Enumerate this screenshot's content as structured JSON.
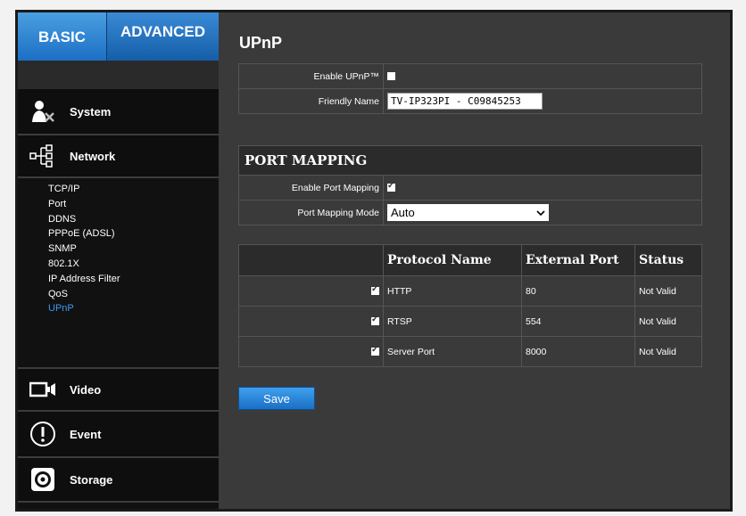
{
  "tabs": {
    "basic": "BASIC",
    "advanced": "ADVANCED"
  },
  "sidebar": {
    "sections": {
      "system": "System",
      "network": "Network",
      "video": "Video",
      "event": "Event",
      "storage": "Storage"
    },
    "network_items": [
      "TCP/IP",
      "Port",
      "DDNS",
      "PPPoE (ADSL)",
      "SNMP",
      "802.1X",
      "IP Address Filter",
      "QoS",
      "UPnP"
    ],
    "active_item": "UPnP"
  },
  "main": {
    "title": "UPnP",
    "enable_upnp_label": "Enable UPnP™",
    "enable_upnp_checked": false,
    "friendly_name_label": "Friendly Name",
    "friendly_name_value": "TV-IP323PI - C09845253",
    "port_mapping_title": "PORT MAPPING",
    "enable_port_mapping_label": "Enable Port Mapping",
    "enable_port_mapping_checked": true,
    "port_mapping_mode_label": "Port Mapping Mode",
    "port_mapping_mode_value": "Auto",
    "table": {
      "headers": [
        "",
        "Protocol Name",
        "External Port",
        "Status"
      ],
      "rows": [
        {
          "checked": true,
          "protocol": "HTTP",
          "port": "80",
          "status": "Not Valid"
        },
        {
          "checked": true,
          "protocol": "RTSP",
          "port": "554",
          "status": "Not Valid"
        },
        {
          "checked": true,
          "protocol": "Server Port",
          "port": "8000",
          "status": "Not Valid"
        }
      ]
    },
    "save_label": "Save"
  }
}
